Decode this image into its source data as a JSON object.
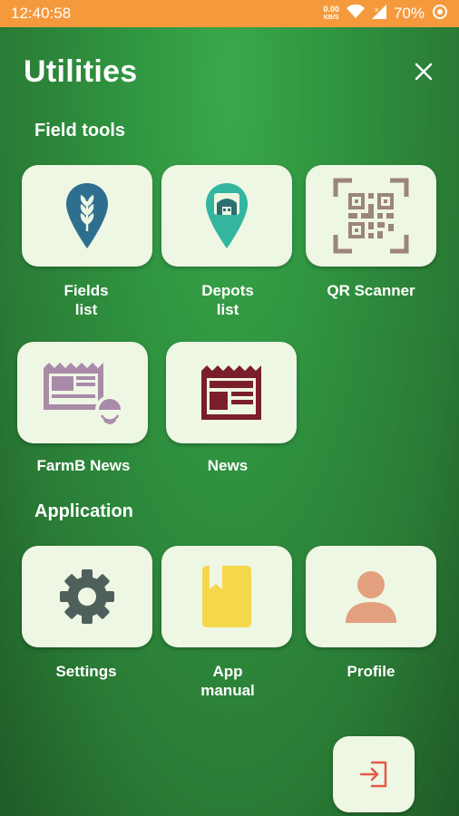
{
  "status_bar": {
    "time": "12:40:58",
    "speed_value": "0.00",
    "speed_unit": "KB/S",
    "battery": "70%"
  },
  "header": {
    "title": "Utilities"
  },
  "sections": {
    "field_tools": "Field tools",
    "application": "Application"
  },
  "field_tools": {
    "fields_list": {
      "line1": "Fields",
      "line2": "list"
    },
    "depots_list": {
      "line1": "Depots",
      "line2": "list"
    },
    "qr_scanner": {
      "label": "QR Scanner"
    },
    "farmb_news": {
      "label": "FarmB News"
    },
    "news": {
      "label": "News"
    }
  },
  "application": {
    "settings": {
      "label": "Settings"
    },
    "app_manual": {
      "line1": "App",
      "line2": "manual"
    },
    "profile": {
      "label": "Profile"
    }
  },
  "colors": {
    "status_bar": "#f59a3c",
    "tile_bg": "#eef6e4",
    "fields_pin": "#2e6e8e",
    "depots_pin": "#33b5a0",
    "qr": "#9b8677",
    "farmb_news": "#a98aa8",
    "news": "#7a1f2a",
    "settings": "#4f5f5c",
    "manual": "#f5d74a",
    "profile": "#e3a07f",
    "exit": "#e6584a"
  }
}
